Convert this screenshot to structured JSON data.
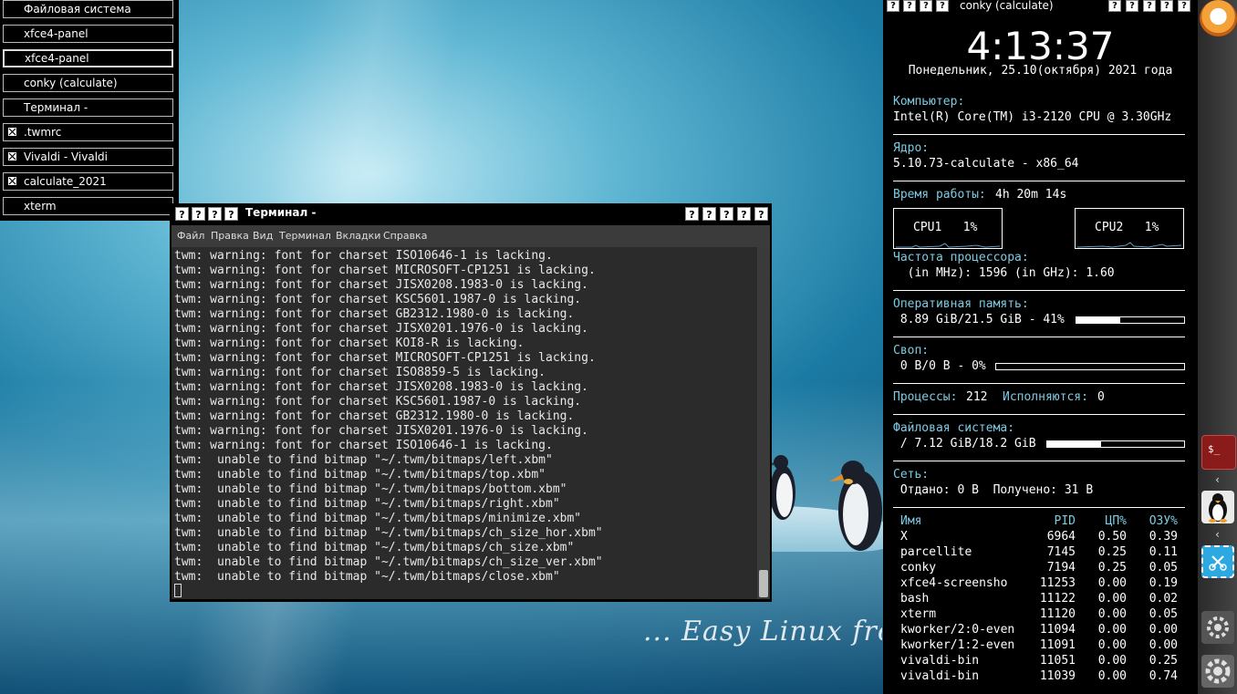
{
  "desktop": {
    "slogan": "... Easy Linux from the"
  },
  "icon_manager": {
    "items": [
      {
        "label": "Файловая система",
        "iconified": false
      },
      {
        "label": "xfce4-panel",
        "iconified": false
      },
      {
        "label": "xfce4-panel",
        "iconified": false,
        "active": true
      },
      {
        "label": "conky (calculate)",
        "iconified": false
      },
      {
        "label": "Терминал -",
        "iconified": false
      },
      {
        "label": ".twmrc",
        "iconified": true
      },
      {
        "label": "Vivaldi - Vivaldi",
        "iconified": true
      },
      {
        "label": "calculate_2021",
        "iconified": true
      },
      {
        "label": "xterm",
        "iconified": false
      }
    ]
  },
  "terminal": {
    "title": "Терминал -",
    "title_button_glyph": "?",
    "menu": [
      "Файл",
      "Правка",
      "Вид",
      "Терминал",
      "Вкладки",
      "Справка"
    ],
    "lines": [
      "twm: warning: font for charset ISO10646-1 is lacking.",
      "twm: warning: font for charset MICROSOFT-CP1251 is lacking.",
      "twm: warning: font for charset JISX0208.1983-0 is lacking.",
      "twm: warning: font for charset KSC5601.1987-0 is lacking.",
      "twm: warning: font for charset GB2312.1980-0 is lacking.",
      "twm: warning: font for charset JISX0201.1976-0 is lacking.",
      "twm: warning: font for charset KOI8-R is lacking.",
      "twm: warning: font for charset MICROSOFT-CP1251 is lacking.",
      "twm: warning: font for charset ISO8859-5 is lacking.",
      "twm: warning: font for charset JISX0208.1983-0 is lacking.",
      "twm: warning: font for charset KSC5601.1987-0 is lacking.",
      "twm: warning: font for charset GB2312.1980-0 is lacking.",
      "twm: warning: font for charset JISX0201.1976-0 is lacking.",
      "twm: warning: font for charset ISO10646-1 is lacking.",
      "twm:  unable to find bitmap \"~/.twm/bitmaps/left.xbm\"",
      "twm:  unable to find bitmap \"~/.twm/bitmaps/top.xbm\"",
      "twm:  unable to find bitmap \"~/.twm/bitmaps/bottom.xbm\"",
      "twm:  unable to find bitmap \"~/.twm/bitmaps/right.xbm\"",
      "twm:  unable to find bitmap \"~/.twm/bitmaps/minimize.xbm\"",
      "twm:  unable to find bitmap \"~/.twm/bitmaps/ch_size_hor.xbm\"",
      "twm:  unable to find bitmap \"~/.twm/bitmaps/ch_size.xbm\"",
      "twm:  unable to find bitmap \"~/.twm/bitmaps/ch_size_ver.xbm\"",
      "twm:  unable to find bitmap \"~/.twm/bitmaps/close.xbm\""
    ]
  },
  "conky": {
    "title": "conky (calculate)",
    "title_button_glyph": "?",
    "time": "4:13:37",
    "date": "Понедельник, 25.10(октября) 2021 года",
    "computer_label": "Компьютер:",
    "computer_value": "Intel(R) Core(TM) i3-2120 CPU @ 3.30GHz",
    "kernel_label": "Ядро:",
    "kernel_value": "5.10.73-calculate - x86_64",
    "uptime_label": "Время работы:",
    "uptime_value": "4h 20m 14s",
    "cpu1": "CPU1   1%",
    "cpu2": "CPU2   1%",
    "freq_label": "Частота процессора:",
    "freq_value": "  (in MHz): 1596 (in GHz): 1.60",
    "ram_label": "Оперативная память:",
    "ram_value": " 8.89 GiB/21.5 GiB - 41%",
    "ram_fraction": 0.41,
    "swap_label": "Своп:",
    "swap_value": " 0 B/0 B - 0%",
    "swap_fraction": 0,
    "proc_label": "Процессы:",
    "proc_value": "212",
    "running_label": "Исполняются:",
    "running_value": "0",
    "fs_label": "Файловая система:",
    "fs_value": " / 7.12 GiB/18.2 GiB",
    "fs_fraction": 0.39,
    "net_label": "Сеть:",
    "net_value": " Отдано: 0 B  Получено: 31 B",
    "proc_table": {
      "headers": [
        "Имя",
        "PID",
        "ЦП%",
        "ОЗУ%"
      ],
      "rows": [
        [
          "X",
          "6964",
          "0.50",
          "0.39"
        ],
        [
          "parcellite",
          "7145",
          "0.25",
          "0.11"
        ],
        [
          "conky",
          "7194",
          "0.25",
          "0.05"
        ],
        [
          "xfce4-screensho",
          "11253",
          "0.00",
          "0.19"
        ],
        [
          "bash",
          "11122",
          "0.00",
          "0.02"
        ],
        [
          "xterm",
          "11120",
          "0.00",
          "0.05"
        ],
        [
          "kworker/2:0-even",
          "11094",
          "0.00",
          "0.00"
        ],
        [
          "kworker/1:2-even",
          "11091",
          "0.00",
          "0.00"
        ],
        [
          "vivaldi-bin",
          "11051",
          "0.00",
          "0.25"
        ],
        [
          "vivaldi-bin",
          "11039",
          "0.00",
          "0.74"
        ]
      ]
    }
  },
  "dock": {
    "terminal_icon_text": "$_",
    "arrow_glyph": "‹"
  },
  "colors": {
    "conky_label": "#7ecbe3",
    "term_bg": "#2b2b2b",
    "dock_terminal": "#8b1a1a"
  }
}
